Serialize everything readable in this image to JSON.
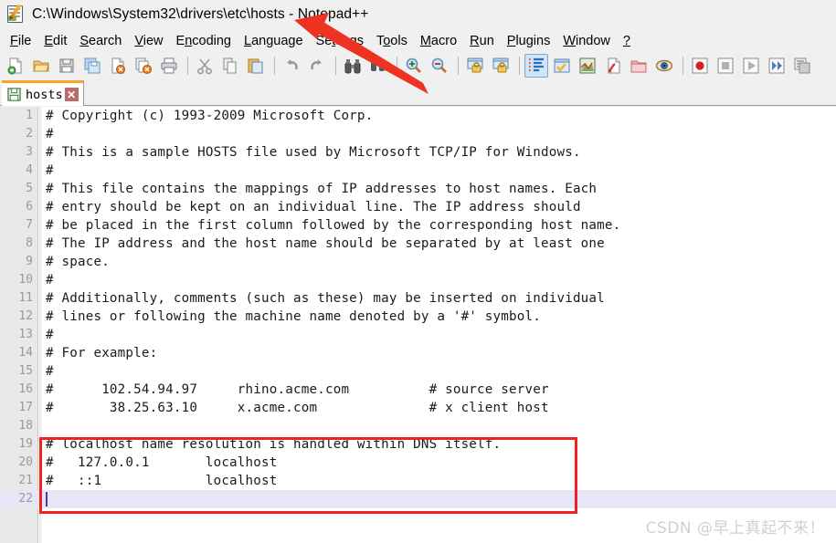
{
  "window": {
    "title": "C:\\Windows\\System32\\drivers\\etc\\hosts - Notepad++",
    "icon": "notepad-plus-plus-icon"
  },
  "menubar": {
    "items": [
      {
        "label": "File",
        "mnemonic": "F"
      },
      {
        "label": "Edit",
        "mnemonic": "E"
      },
      {
        "label": "Search",
        "mnemonic": "S"
      },
      {
        "label": "View",
        "mnemonic": "V"
      },
      {
        "label": "Encoding",
        "mnemonic": "n"
      },
      {
        "label": "Language",
        "mnemonic": "L"
      },
      {
        "label": "Settings",
        "mnemonic": "t"
      },
      {
        "label": "Tools",
        "mnemonic": "o"
      },
      {
        "label": "Macro",
        "mnemonic": "M"
      },
      {
        "label": "Run",
        "mnemonic": "R"
      },
      {
        "label": "Plugins",
        "mnemonic": "P"
      },
      {
        "label": "Window",
        "mnemonic": "W"
      },
      {
        "label": "?",
        "mnemonic": "?"
      }
    ]
  },
  "toolbar": {
    "buttons": [
      {
        "name": "new-file-icon",
        "tip": "New"
      },
      {
        "name": "open-folder-icon",
        "tip": "Open"
      },
      {
        "name": "save-icon",
        "tip": "Save"
      },
      {
        "name": "save-all-icon",
        "tip": "Save All"
      },
      {
        "name": "close-file-icon",
        "tip": "Close"
      },
      {
        "name": "close-all-files-icon",
        "tip": "Close All"
      },
      {
        "name": "print-icon",
        "tip": "Print"
      },
      {
        "name": "separator",
        "tip": ""
      },
      {
        "name": "cut-scissors-icon",
        "tip": "Cut"
      },
      {
        "name": "copy-icon",
        "tip": "Copy"
      },
      {
        "name": "paste-icon",
        "tip": "Paste"
      },
      {
        "name": "separator",
        "tip": ""
      },
      {
        "name": "undo-arrow-icon",
        "tip": "Undo"
      },
      {
        "name": "redo-arrow-icon",
        "tip": "Redo"
      },
      {
        "name": "separator",
        "tip": ""
      },
      {
        "name": "find-binoculars-icon",
        "tip": "Find"
      },
      {
        "name": "replace-icon",
        "tip": "Replace"
      },
      {
        "name": "separator",
        "tip": ""
      },
      {
        "name": "zoom-in-icon",
        "tip": "Zoom In"
      },
      {
        "name": "zoom-out-icon",
        "tip": "Zoom Out"
      },
      {
        "name": "separator",
        "tip": ""
      },
      {
        "name": "sync-vertical-scroll-icon",
        "tip": "Synchronize Vertical Scrolling"
      },
      {
        "name": "sync-horizontal-scroll-icon",
        "tip": "Synchronize Horizontal Scrolling"
      },
      {
        "name": "separator",
        "tip": ""
      },
      {
        "name": "word-wrap-icon",
        "tip": "Word Wrap"
      },
      {
        "name": "show-all-characters-icon",
        "tip": "Show All Characters"
      },
      {
        "name": "show-indent-guide-icon",
        "tip": "Show Indent Guide"
      },
      {
        "name": "user-defined-dialog-icon",
        "tip": "User Defined Dialogue"
      },
      {
        "name": "document-map-icon",
        "tip": "Document Map"
      },
      {
        "name": "function-list-icon",
        "tip": "Function List"
      },
      {
        "name": "folder-as-workspace-icon",
        "tip": "Folder as Workspace"
      },
      {
        "name": "monitoring-eye-icon",
        "tip": "Monitoring"
      },
      {
        "name": "separator",
        "tip": ""
      },
      {
        "name": "record-macro-icon",
        "tip": "Start Recording"
      },
      {
        "name": "stop-macro-icon",
        "tip": "Stop Recording"
      },
      {
        "name": "play-macro-icon",
        "tip": "Playback"
      },
      {
        "name": "run-macro-multiple-icon",
        "tip": "Run a Macro Multiple Times"
      },
      {
        "name": "save-macro-icon",
        "tip": "Save Currently Recorded Macro"
      }
    ],
    "active_index": 24
  },
  "tabs": [
    {
      "label": "hosts",
      "close_label": "✕",
      "icon": "floppy-save-icon",
      "active": true
    }
  ],
  "editor": {
    "current_line": 22,
    "lines": [
      {
        "n": "1",
        "text": "# Copyright (c) 1993-2009 Microsoft Corp."
      },
      {
        "n": "2",
        "text": "#"
      },
      {
        "n": "3",
        "text": "# This is a sample HOSTS file used by Microsoft TCP/IP for Windows."
      },
      {
        "n": "4",
        "text": "#"
      },
      {
        "n": "5",
        "text": "# This file contains the mappings of IP addresses to host names. Each"
      },
      {
        "n": "6",
        "text": "# entry should be kept on an individual line. The IP address should"
      },
      {
        "n": "7",
        "text": "# be placed in the first column followed by the corresponding host name."
      },
      {
        "n": "8",
        "text": "# The IP address and the host name should be separated by at least one"
      },
      {
        "n": "9",
        "text": "# space."
      },
      {
        "n": "10",
        "text": "#"
      },
      {
        "n": "11",
        "text": "# Additionally, comments (such as these) may be inserted on individual"
      },
      {
        "n": "12",
        "text": "# lines or following the machine name denoted by a '#' symbol."
      },
      {
        "n": "13",
        "text": "#"
      },
      {
        "n": "14",
        "text": "# For example:"
      },
      {
        "n": "15",
        "text": "#"
      },
      {
        "n": "16",
        "text": "#      102.54.94.97     rhino.acme.com          # source server"
      },
      {
        "n": "17",
        "text": "#       38.25.63.10     x.acme.com              # x client host"
      },
      {
        "n": "18",
        "text": ""
      },
      {
        "n": "19",
        "text": "# localhost name resolution is handled within DNS itself."
      },
      {
        "n": "20",
        "text": "#   127.0.0.1       localhost"
      },
      {
        "n": "21",
        "text": "#   ::1             localhost"
      },
      {
        "n": "22",
        "text": ""
      }
    ]
  },
  "annotations": {
    "highlight_box": {
      "color": "#ee2222",
      "covers_lines": "19-22"
    },
    "arrow": {
      "color": "#ee2222",
      "points_to": "Language menu"
    }
  },
  "watermark": {
    "text": "CSDN @早上真起不来！",
    "color": "#cfcfd6"
  }
}
